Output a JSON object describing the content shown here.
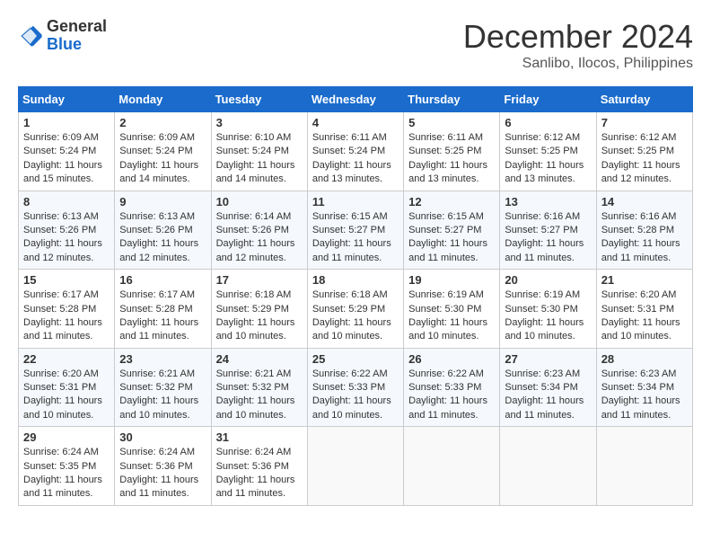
{
  "header": {
    "logo_line1": "General",
    "logo_line2": "Blue",
    "month_year": "December 2024",
    "location": "Sanlibo, Ilocos, Philippines"
  },
  "weekdays": [
    "Sunday",
    "Monday",
    "Tuesday",
    "Wednesday",
    "Thursday",
    "Friday",
    "Saturday"
  ],
  "weeks": [
    [
      {
        "day": "1",
        "info": "Sunrise: 6:09 AM\nSunset: 5:24 PM\nDaylight: 11 hours and 15 minutes."
      },
      {
        "day": "2",
        "info": "Sunrise: 6:09 AM\nSunset: 5:24 PM\nDaylight: 11 hours and 14 minutes."
      },
      {
        "day": "3",
        "info": "Sunrise: 6:10 AM\nSunset: 5:24 PM\nDaylight: 11 hours and 14 minutes."
      },
      {
        "day": "4",
        "info": "Sunrise: 6:11 AM\nSunset: 5:24 PM\nDaylight: 11 hours and 13 minutes."
      },
      {
        "day": "5",
        "info": "Sunrise: 6:11 AM\nSunset: 5:25 PM\nDaylight: 11 hours and 13 minutes."
      },
      {
        "day": "6",
        "info": "Sunrise: 6:12 AM\nSunset: 5:25 PM\nDaylight: 11 hours and 13 minutes."
      },
      {
        "day": "7",
        "info": "Sunrise: 6:12 AM\nSunset: 5:25 PM\nDaylight: 11 hours and 12 minutes."
      }
    ],
    [
      {
        "day": "8",
        "info": "Sunrise: 6:13 AM\nSunset: 5:26 PM\nDaylight: 11 hours and 12 minutes."
      },
      {
        "day": "9",
        "info": "Sunrise: 6:13 AM\nSunset: 5:26 PM\nDaylight: 11 hours and 12 minutes."
      },
      {
        "day": "10",
        "info": "Sunrise: 6:14 AM\nSunset: 5:26 PM\nDaylight: 11 hours and 12 minutes."
      },
      {
        "day": "11",
        "info": "Sunrise: 6:15 AM\nSunset: 5:27 PM\nDaylight: 11 hours and 11 minutes."
      },
      {
        "day": "12",
        "info": "Sunrise: 6:15 AM\nSunset: 5:27 PM\nDaylight: 11 hours and 11 minutes."
      },
      {
        "day": "13",
        "info": "Sunrise: 6:16 AM\nSunset: 5:27 PM\nDaylight: 11 hours and 11 minutes."
      },
      {
        "day": "14",
        "info": "Sunrise: 6:16 AM\nSunset: 5:28 PM\nDaylight: 11 hours and 11 minutes."
      }
    ],
    [
      {
        "day": "15",
        "info": "Sunrise: 6:17 AM\nSunset: 5:28 PM\nDaylight: 11 hours and 11 minutes."
      },
      {
        "day": "16",
        "info": "Sunrise: 6:17 AM\nSunset: 5:28 PM\nDaylight: 11 hours and 11 minutes."
      },
      {
        "day": "17",
        "info": "Sunrise: 6:18 AM\nSunset: 5:29 PM\nDaylight: 11 hours and 10 minutes."
      },
      {
        "day": "18",
        "info": "Sunrise: 6:18 AM\nSunset: 5:29 PM\nDaylight: 11 hours and 10 minutes."
      },
      {
        "day": "19",
        "info": "Sunrise: 6:19 AM\nSunset: 5:30 PM\nDaylight: 11 hours and 10 minutes."
      },
      {
        "day": "20",
        "info": "Sunrise: 6:19 AM\nSunset: 5:30 PM\nDaylight: 11 hours and 10 minutes."
      },
      {
        "day": "21",
        "info": "Sunrise: 6:20 AM\nSunset: 5:31 PM\nDaylight: 11 hours and 10 minutes."
      }
    ],
    [
      {
        "day": "22",
        "info": "Sunrise: 6:20 AM\nSunset: 5:31 PM\nDaylight: 11 hours and 10 minutes."
      },
      {
        "day": "23",
        "info": "Sunrise: 6:21 AM\nSunset: 5:32 PM\nDaylight: 11 hours and 10 minutes."
      },
      {
        "day": "24",
        "info": "Sunrise: 6:21 AM\nSunset: 5:32 PM\nDaylight: 11 hours and 10 minutes."
      },
      {
        "day": "25",
        "info": "Sunrise: 6:22 AM\nSunset: 5:33 PM\nDaylight: 11 hours and 10 minutes."
      },
      {
        "day": "26",
        "info": "Sunrise: 6:22 AM\nSunset: 5:33 PM\nDaylight: 11 hours and 11 minutes."
      },
      {
        "day": "27",
        "info": "Sunrise: 6:23 AM\nSunset: 5:34 PM\nDaylight: 11 hours and 11 minutes."
      },
      {
        "day": "28",
        "info": "Sunrise: 6:23 AM\nSunset: 5:34 PM\nDaylight: 11 hours and 11 minutes."
      }
    ],
    [
      {
        "day": "29",
        "info": "Sunrise: 6:24 AM\nSunset: 5:35 PM\nDaylight: 11 hours and 11 minutes."
      },
      {
        "day": "30",
        "info": "Sunrise: 6:24 AM\nSunset: 5:36 PM\nDaylight: 11 hours and 11 minutes."
      },
      {
        "day": "31",
        "info": "Sunrise: 6:24 AM\nSunset: 5:36 PM\nDaylight: 11 hours and 11 minutes."
      },
      null,
      null,
      null,
      null
    ]
  ]
}
